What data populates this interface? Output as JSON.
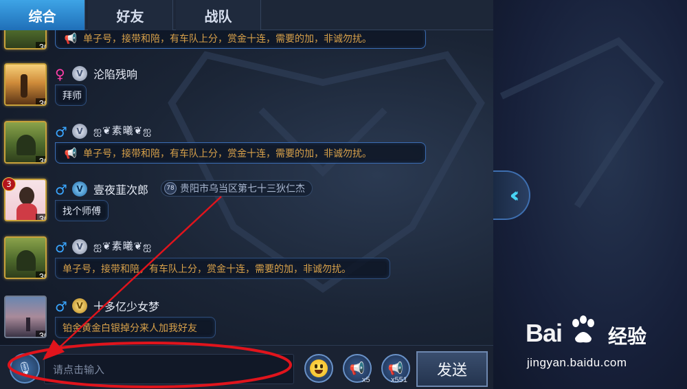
{
  "tabs": [
    {
      "label": "综合",
      "active": true
    },
    {
      "label": "好友",
      "active": false
    },
    {
      "label": "战队",
      "active": false
    }
  ],
  "messages": [
    {
      "level": "30",
      "text": "单子号，接带和陪，有车队上分，赏金十连，需要的加，非诚勿扰。"
    },
    {
      "gender": "♀",
      "rank": "V",
      "name": "沦陷残响",
      "level": "30",
      "text": "拜师"
    },
    {
      "gender": "♂",
      "rank": "V",
      "name": "ஐ❦素曦❦ஐ",
      "level": "30",
      "text": "单子号，接带和陪，有车队上分，赏金十连，需要的加，非诚勿扰。"
    },
    {
      "gender": "♂",
      "rank": "V",
      "name": "壹夜韮次郎",
      "location_badge": "78",
      "location": "贵阳市乌当区第七十三狄仁杰",
      "level": "30",
      "badge": "3",
      "text": "找个师傅"
    },
    {
      "gender": "♂",
      "rank": "V",
      "name": "ஐ❦素曦❦ஐ",
      "level": "30",
      "text": "单子号，接带和陪，有车队上分，赏金十连，需要的加，非诚勿扰。"
    },
    {
      "gender": "♂",
      "rank": "V",
      "name": "十多亿少女梦",
      "level": "30",
      "text": "铂金黄金白银掉分来人加我好友"
    }
  ],
  "input": {
    "placeholder": "请点击输入"
  },
  "toolbar": {
    "horn_gold_count": "x5",
    "horn_blue_count": "x551",
    "send_label": "发送"
  },
  "icons": {
    "voice": "microphone-icon",
    "emoji": "smiley-icon",
    "horn": "megaphone-icon",
    "collapse": "double-chevron-left-icon"
  },
  "colors": {
    "active_tab": "#2f8fd8",
    "horn_text": "#d8a14a",
    "annotation": "#e0141c",
    "collapse_accent": "#48d3f4"
  },
  "watermark": {
    "brand": "Bai",
    "brand_cn": "经验",
    "url": "jingyan.baidu.com"
  }
}
